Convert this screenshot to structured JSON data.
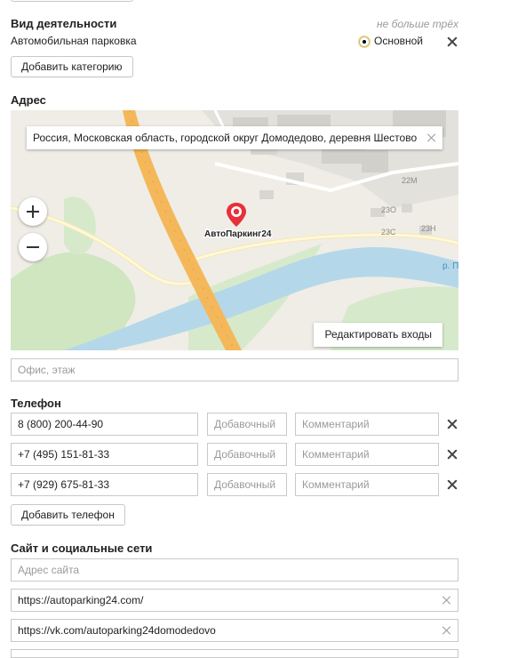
{
  "activity": {
    "title": "Вид деятельности",
    "limit_hint": "не больше трёх",
    "category": "Автомобильная парковка",
    "primary_label": "Основной",
    "add_category_label": "Добавить категорию"
  },
  "address": {
    "title": "Адрес",
    "full_address": "Россия, Московская область, городской округ Домодедово, деревня Шестово",
    "map_marker_label": "АвтоПаркинг24",
    "map_labels": [
      "22М",
      "23О",
      "23С",
      "23Н",
      "р. П"
    ],
    "edit_entries_label": "Редактировать входы",
    "office_placeholder": "Офис, этаж"
  },
  "phone": {
    "title": "Телефон",
    "rows": [
      {
        "number": "8 (800) 200-44-90",
        "ext_placeholder": "Добавочный",
        "comment_placeholder": "Комментарий"
      },
      {
        "number": "+7 (495) 151-81-33",
        "ext_placeholder": "Добавочный",
        "comment_placeholder": "Комментарий"
      },
      {
        "number": "+7 (929) 675-81-33",
        "ext_placeholder": "Добавочный",
        "comment_placeholder": "Комментарий"
      }
    ],
    "add_phone_label": "Добавить телефон"
  },
  "sites": {
    "title": "Сайт и социальные сети",
    "site_placeholder": "Адрес сайта",
    "links": [
      "https://autoparking24.com/",
      "https://vk.com/autoparking24domodedovo"
    ]
  },
  "colors": {
    "radio_accent": "#ffdb4d",
    "marker_red": "#e8303a",
    "road_orange": "#f4b85a",
    "water_blue": "#b5d7ea"
  }
}
